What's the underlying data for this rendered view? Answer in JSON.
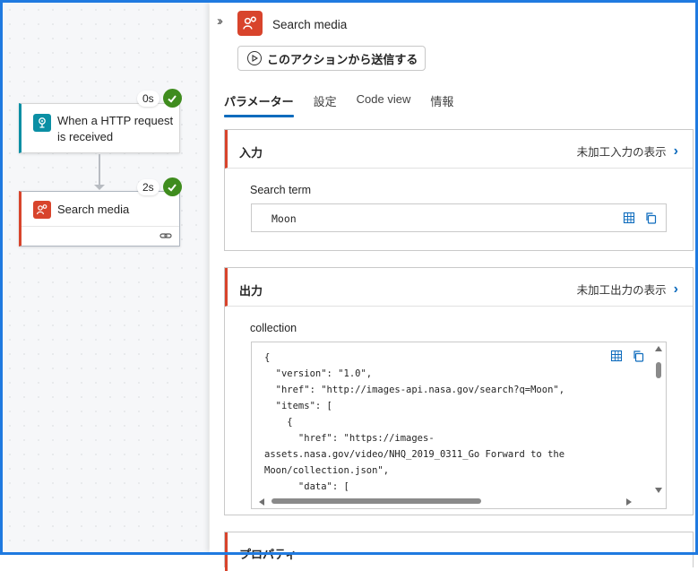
{
  "canvas": {
    "nodes": [
      {
        "title": "When a HTTP request is received",
        "duration": "0s",
        "status": "succeeded",
        "icon": "http-request-icon",
        "color": "#0b8fa4"
      },
      {
        "title": "Search media",
        "duration": "2s",
        "status": "succeeded",
        "icon": "media-search-icon",
        "color": "#d8442c"
      }
    ]
  },
  "panel": {
    "title": "Search media",
    "submit_button": "このアクションから送信する",
    "tabs": [
      {
        "label": "パラメーター",
        "active": true
      },
      {
        "label": "設定",
        "active": false
      },
      {
        "label": "Code view",
        "active": false
      },
      {
        "label": "情報",
        "active": false
      }
    ],
    "input_section": {
      "title": "入力",
      "raw_link": "未加工入力の表示",
      "field_label": "Search term",
      "field_value": "Moon"
    },
    "output_section": {
      "title": "出力",
      "raw_link": "未加工出力の表示",
      "field_label": "collection",
      "code": "{\n  \"version\": \"1.0\",\n  \"href\": \"http://images-api.nasa.gov/search?q=Moon\",\n  \"items\": [\n    {\n      \"href\": \"https://images-\nassets.nasa.gov/video/NHQ_2019_0311_Go Forward to the\nMoon/collection.json\",\n      \"data\": ["
    },
    "properties_section": {
      "title": "プロパティ"
    }
  },
  "colors": {
    "accent": "#0f6cbd",
    "action_red": "#d8442c",
    "trigger_teal": "#0b8fa4",
    "success_green": "#3f8c1e"
  }
}
